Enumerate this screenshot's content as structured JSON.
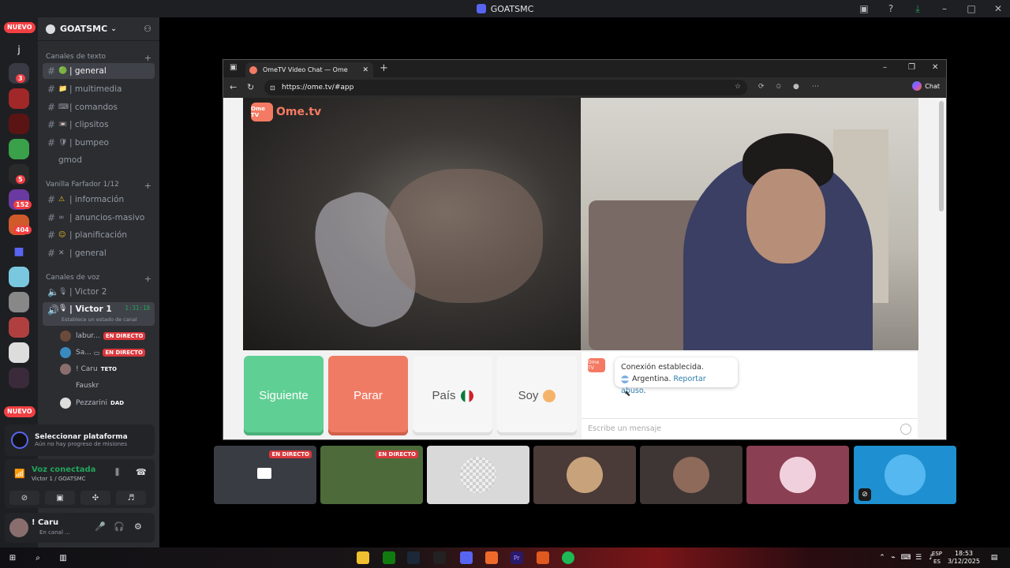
{
  "window": {
    "title": "GOATSMC"
  },
  "rail": {
    "badges": [
      "3",
      "5",
      "152",
      "404"
    ],
    "nuevo": "NUEVO",
    "dm_label": "j"
  },
  "guild": {
    "name": "GOATSMC",
    "text_category": "Canales de texto",
    "text_channels": [
      {
        "label": "| general",
        "emoji": "🟢"
      },
      {
        "label": "| multimedia",
        "emoji": "📁"
      },
      {
        "label": "| comandos",
        "emoji": "⌨"
      },
      {
        "label": "| clipsitos",
        "emoji": "📼"
      },
      {
        "label": "| bumpeo",
        "emoji": "🛡"
      },
      {
        "label": "gmod",
        "emoji": ""
      }
    ],
    "vanilla_category": "Vanilla Farfador 1/12",
    "vanilla_channels": [
      {
        "label": "| información",
        "emoji": "⚠"
      },
      {
        "label": "| anuncios-masivo",
        "emoji": "∞"
      },
      {
        "label": "| planificación",
        "emoji": "☺"
      },
      {
        "label": "| general",
        "emoji": "✕"
      }
    ],
    "voice_category": "Canales de voz",
    "voice_channels": [
      {
        "label": "| Victor 2"
      },
      {
        "label": "| Victor 1",
        "timer": "1:31:18",
        "status": "Establece un estado de canal"
      }
    ],
    "voice_users": [
      {
        "name": "labur...",
        "tag": "EN DIRECTO"
      },
      {
        "name": "Sa...",
        "tag": "EN DIRECTO"
      },
      {
        "name": "! Caru",
        "tag": "TETO"
      },
      {
        "name": "Fauskr",
        "tag": ""
      },
      {
        "name": "Pezzarini",
        "tag": "DAD"
      }
    ]
  },
  "platform": {
    "title": "Seleccionar plataforma",
    "subtitle": "Aún no hay progreso de misiones"
  },
  "voice_panel": {
    "status": "Voz conectada",
    "channel": "Victor 1 / GOATSMC"
  },
  "user": {
    "name": "! Caru",
    "status": "En canal ..."
  },
  "browser": {
    "tab_title": "OmeTV Video Chat — Ome",
    "url": "https://ome.tv/#app",
    "chat_label": "Chat"
  },
  "ometv": {
    "logo": "Ome.tv",
    "logo_box": "Ome TV",
    "buttons": {
      "next": "Siguiente",
      "stop": "Parar",
      "country": "País",
      "me": "Soy"
    },
    "message_line1": "Conexión establecida.",
    "country_name": "Argentina.",
    "report_link": "Reportar abuso",
    "report_tail": ".",
    "input_placeholder": "Escribe un mensaje"
  },
  "tiles": [
    {
      "live": "EN DIRECTO",
      "color": "#3a3c44"
    },
    {
      "live": "EN DIRECTO",
      "color": "#4d6b3a"
    },
    {
      "live": "",
      "color": "#d9d9d9"
    },
    {
      "live": "",
      "color": "#4a3a38"
    },
    {
      "live": "",
      "color": "#3e3634"
    },
    {
      "live": "",
      "color": "#8a3f52"
    },
    {
      "live": "",
      "color": "#1e8fd0"
    }
  ],
  "taskbar": {
    "time": "18:53",
    "date": "3/12/2025",
    "lang1": "ESP",
    "lang2": "ES"
  }
}
